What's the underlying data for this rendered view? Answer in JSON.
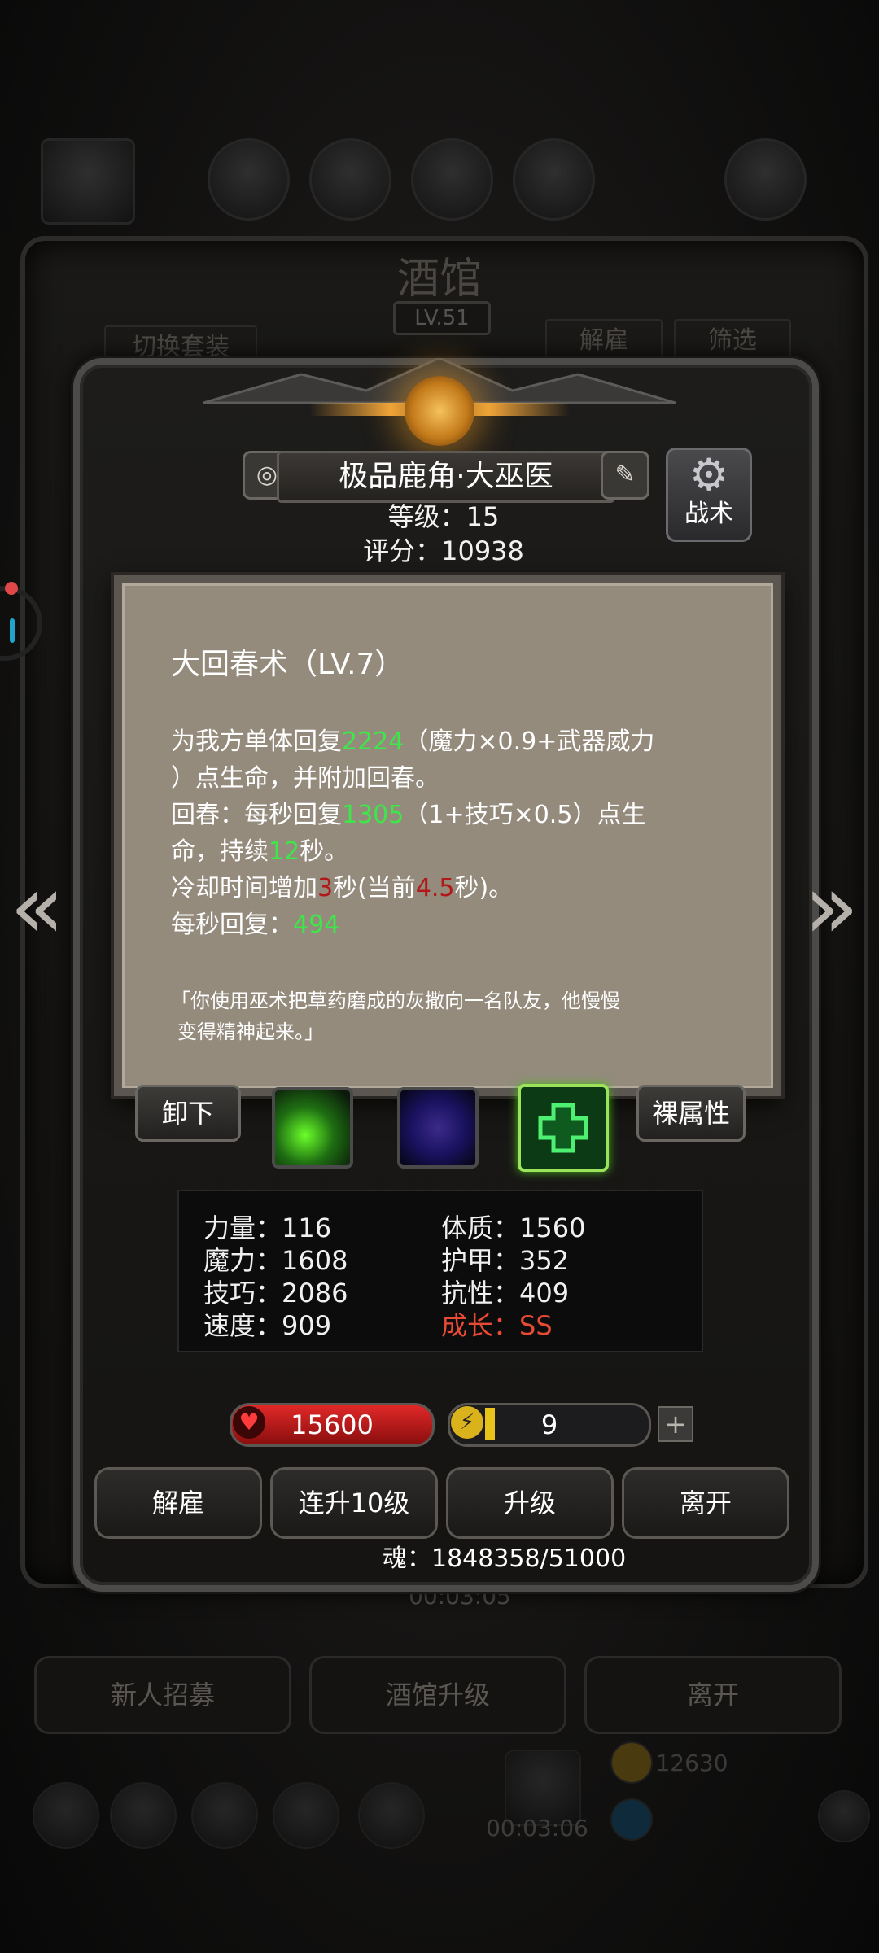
{
  "background": {
    "title": "酒馆",
    "level": "LV.51",
    "left_tab": "切换套装",
    "right_tabs": [
      "解雇",
      "筛选"
    ],
    "timer_top": "00:03:05",
    "buttons": [
      "新人招募",
      "酒馆升级",
      "离开"
    ],
    "timer_bottom": "00:03:06",
    "coin_partial": "12630"
  },
  "hero": {
    "name": "极品鹿角·大巫医",
    "level_text": "等级：15",
    "score_text": "评分：10938",
    "tactic_label": "战术"
  },
  "skill_popup": {
    "title": "大回春术（LV.7）",
    "lines": [
      {
        "a": "为我方单体回复",
        "g": "2224",
        "b": "（魔力×0.9+武器威力"
      },
      {
        "a": "）点生命，并附加回春。"
      },
      {
        "a": "回春：每秒回复",
        "g": "1305",
        "b": "（1+技巧×0.5）点生"
      },
      {
        "a": "命，持续",
        "g": "12",
        "b": "秒。"
      },
      {
        "a": "冷却时间增加",
        "r": "3",
        "b": "秒(当前",
        "r2": "4.5",
        "c": "秒)。"
      },
      {
        "a": "每秒回复：",
        "g": "494"
      }
    ],
    "quote_line1": "「你使用巫术把草药磨成的灰撒向一名队友，他慢慢",
    "quote_line2": "变得精神起来。」"
  },
  "controls": {
    "unequip": "卸下",
    "naked_attrs": "裸属性"
  },
  "attributes": {
    "strength": "力量：116",
    "magic": "魔力：1608",
    "skill": "技巧：2086",
    "speed": "速度：909",
    "constitution": "体质：1560",
    "armor": "护甲：352",
    "resistance": "抗性：409",
    "growth": "成长：SS"
  },
  "resources": {
    "hp": "15600",
    "energy": "9",
    "energy_fill_fraction": 0.05
  },
  "actions": [
    "解雇",
    "连升10级",
    "升级",
    "离开"
  ],
  "soul": "魂：1848358/51000",
  "colors": {
    "green_value": "#3ee64a",
    "red_value": "#b11818",
    "growth_red": "#e84a34"
  }
}
